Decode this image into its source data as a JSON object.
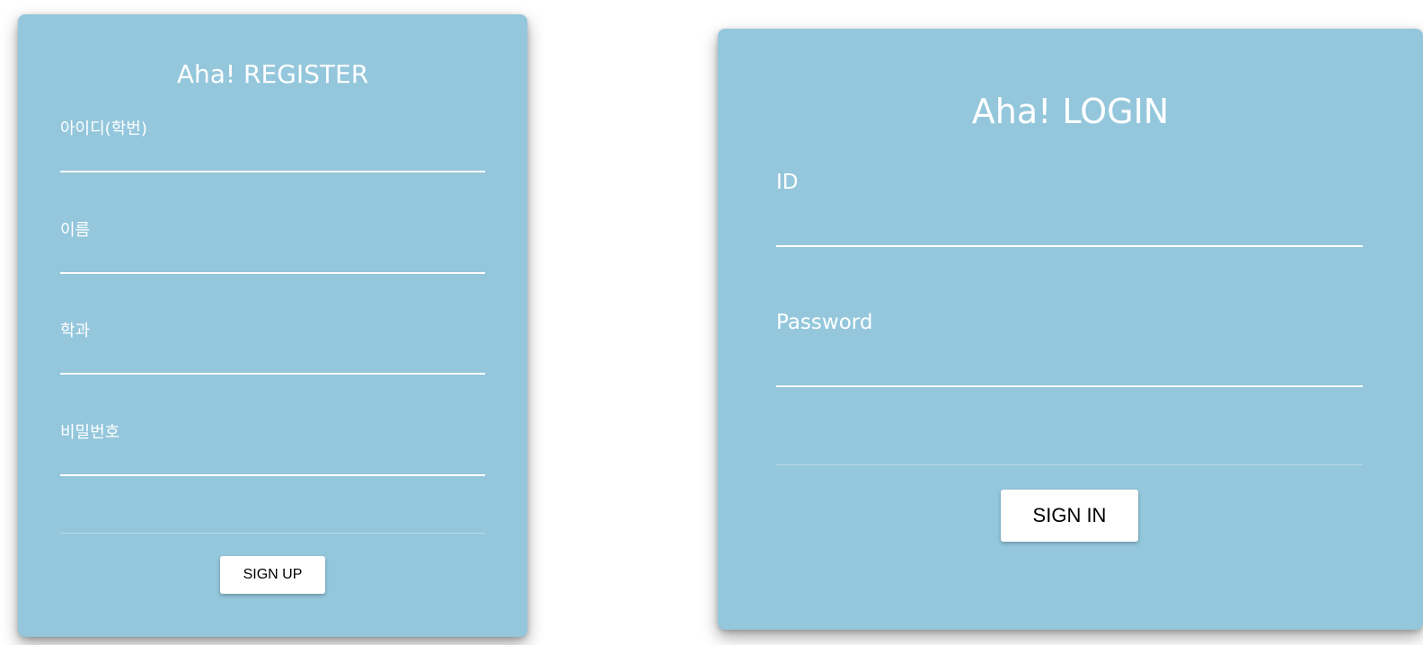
{
  "register": {
    "title": "Aha! REGISTER",
    "fields": [
      {
        "label": "아이디(학번)",
        "value": ""
      },
      {
        "label": "이름",
        "value": ""
      },
      {
        "label": "학과",
        "value": ""
      },
      {
        "label": "비밀번호",
        "value": ""
      }
    ],
    "button_label": "SIGN UP"
  },
  "login": {
    "title": "Aha! LOGIN",
    "fields": [
      {
        "label": "ID",
        "value": ""
      },
      {
        "label": "Password",
        "value": ""
      }
    ],
    "button_label": "SIGN IN"
  },
  "colors": {
    "card_background": "#94c7dc",
    "text": "#ffffff",
    "button_background": "#ffffff",
    "button_text": "#000000"
  }
}
